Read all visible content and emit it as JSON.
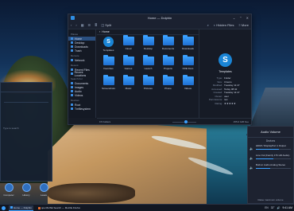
{
  "window": {
    "title": "Home — Dolphin"
  },
  "toolbar": {
    "split_label": "Split",
    "icons_label": "",
    "hidden_files_label": "Hidden Files",
    "more_label": "More"
  },
  "sidebar": {
    "places_heading": "Places",
    "places": [
      "Home",
      "Desktop",
      "Downloads",
      "Trash"
    ],
    "remote_heading": "Remote",
    "remote": [
      "Network"
    ],
    "recent_heading": "Recent",
    "recent": [
      "Recent Files",
      "Recent Locations"
    ],
    "search_heading": "Search For",
    "search": [
      "Documents",
      "Images",
      "Audio",
      "Videos"
    ],
    "devices_heading": "Devices",
    "devices": [
      "Root",
      "Tmfilesystem"
    ]
  },
  "path": {
    "crumb": "Home"
  },
  "files": [
    {
      "name": "Templates",
      "kind": "app"
    },
    {
      "name": "Cloud",
      "kind": "folder"
    },
    {
      "name": "Desktop",
      "kind": "folder"
    },
    {
      "name": "Documents",
      "kind": "folder"
    },
    {
      "name": "Downloads",
      "kind": "folder"
    },
    {
      "name": "Favorites",
      "kind": "folder"
    },
    {
      "name": "Games",
      "kind": "folder"
    },
    {
      "name": "Launch",
      "kind": "folder"
    },
    {
      "name": "Projects",
      "kind": "folder"
    },
    {
      "name": "KDE Docs",
      "kind": "folder"
    },
    {
      "name": "Screenshots",
      "kind": "folder"
    },
    {
      "name": "Music",
      "kind": "folder"
    },
    {
      "name": "Pictures",
      "kind": "folder"
    },
    {
      "name": "Phone",
      "kind": "folder"
    },
    {
      "name": "Videos",
      "kind": "folder"
    }
  ],
  "info_panel": {
    "name": "Templates",
    "rows": [
      {
        "k": "Type:",
        "v": "Folder"
      },
      {
        "k": "Size:",
        "v": "3 items"
      },
      {
        "k": "Modified:",
        "v": "Tuesday 11:47"
      },
      {
        "k": "Accessed:",
        "v": "Today 08:42"
      },
      {
        "k": "Created:",
        "v": "Tuesday 11:47"
      },
      {
        "k": "Owner:",
        "v": "user"
      },
      {
        "k": "Permissions:",
        "v": "rwx"
      },
      {
        "k": "Rating:",
        "v": "★★★★★"
      }
    ]
  },
  "status": {
    "count": "15 Folders",
    "free": "155.0 GiB free"
  },
  "audio": {
    "title": "Audio Volume",
    "tab": "Devices",
    "rows": [
      "HDMI / DisplayPort 1 Output",
      "Line Out (Family 17h HD Audio)",
      "Built-in Audio Analog Stereo"
    ],
    "levels": [
      0.65,
      0.5,
      0.4
    ],
    "footer": "Raise maximum volume"
  },
  "left_panel": {
    "hint": "Type to search",
    "launchers": [
      "Computer",
      "History",
      "Leave"
    ]
  },
  "taskbar": {
    "tasks": [
      {
        "label": "Home — Dolphin",
        "color": "#3aa0ff",
        "active": true
      },
      {
        "label": "openSUSE Search — Mozilla Firefox",
        "color": "#e66b2e",
        "active": false
      }
    ],
    "tray": [
      "EN",
      "32°"
    ],
    "clock": "9:41 AM"
  }
}
